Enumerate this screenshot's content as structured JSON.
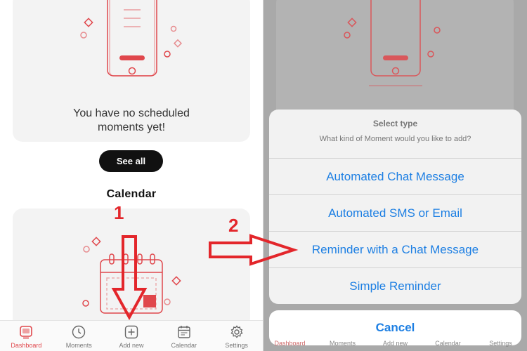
{
  "left": {
    "empty_message_line1": "You have no scheduled",
    "empty_message_line2": "moments yet!",
    "see_all_label": "See all",
    "calendar_title": "Calendar",
    "tabs": [
      {
        "label": "Dashboard",
        "icon": "dashboard-icon",
        "active": true
      },
      {
        "label": "Moments",
        "icon": "clock-icon",
        "active": false
      },
      {
        "label": "Add new",
        "icon": "plus-square-icon",
        "active": false
      },
      {
        "label": "Calendar",
        "icon": "calendar-icon",
        "active": false
      },
      {
        "label": "Settings",
        "icon": "gear-icon",
        "active": false
      }
    ]
  },
  "action_sheet": {
    "title": "Select type",
    "subtitle": "What kind of Moment would you like to add?",
    "options": [
      "Automated Chat Message",
      "Automated SMS or Email",
      "Reminder with a Chat Message",
      "Simple Reminder"
    ],
    "cancel_label": "Cancel"
  },
  "right_tabs": [
    "Dashboard",
    "Moments",
    "Add new",
    "Calendar",
    "Settings"
  ],
  "annotations": {
    "step1": "1",
    "step2": "2"
  },
  "colors": {
    "accent": "#e0474c",
    "ios_blue": "#1d7fe3",
    "annotation_red": "#e3262b",
    "dim": "#a9a9a9"
  }
}
